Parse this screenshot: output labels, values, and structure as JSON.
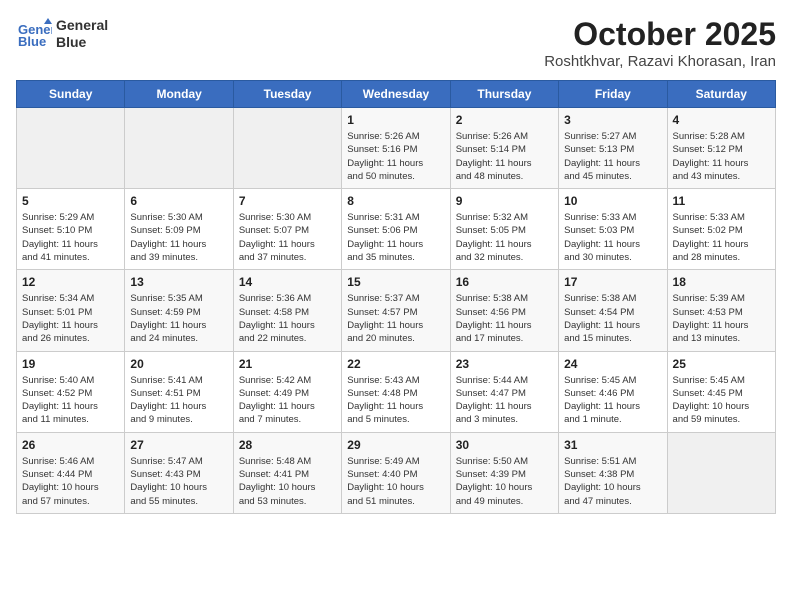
{
  "header": {
    "logo_line1": "General",
    "logo_line2": "Blue",
    "month": "October 2025",
    "location": "Roshtkhvar, Razavi Khorasan, Iran"
  },
  "weekdays": [
    "Sunday",
    "Monday",
    "Tuesday",
    "Wednesday",
    "Thursday",
    "Friday",
    "Saturday"
  ],
  "weeks": [
    [
      {
        "day": "",
        "info": ""
      },
      {
        "day": "",
        "info": ""
      },
      {
        "day": "",
        "info": ""
      },
      {
        "day": "1",
        "info": "Sunrise: 5:26 AM\nSunset: 5:16 PM\nDaylight: 11 hours\nand 50 minutes."
      },
      {
        "day": "2",
        "info": "Sunrise: 5:26 AM\nSunset: 5:14 PM\nDaylight: 11 hours\nand 48 minutes."
      },
      {
        "day": "3",
        "info": "Sunrise: 5:27 AM\nSunset: 5:13 PM\nDaylight: 11 hours\nand 45 minutes."
      },
      {
        "day": "4",
        "info": "Sunrise: 5:28 AM\nSunset: 5:12 PM\nDaylight: 11 hours\nand 43 minutes."
      }
    ],
    [
      {
        "day": "5",
        "info": "Sunrise: 5:29 AM\nSunset: 5:10 PM\nDaylight: 11 hours\nand 41 minutes."
      },
      {
        "day": "6",
        "info": "Sunrise: 5:30 AM\nSunset: 5:09 PM\nDaylight: 11 hours\nand 39 minutes."
      },
      {
        "day": "7",
        "info": "Sunrise: 5:30 AM\nSunset: 5:07 PM\nDaylight: 11 hours\nand 37 minutes."
      },
      {
        "day": "8",
        "info": "Sunrise: 5:31 AM\nSunset: 5:06 PM\nDaylight: 11 hours\nand 35 minutes."
      },
      {
        "day": "9",
        "info": "Sunrise: 5:32 AM\nSunset: 5:05 PM\nDaylight: 11 hours\nand 32 minutes."
      },
      {
        "day": "10",
        "info": "Sunrise: 5:33 AM\nSunset: 5:03 PM\nDaylight: 11 hours\nand 30 minutes."
      },
      {
        "day": "11",
        "info": "Sunrise: 5:33 AM\nSunset: 5:02 PM\nDaylight: 11 hours\nand 28 minutes."
      }
    ],
    [
      {
        "day": "12",
        "info": "Sunrise: 5:34 AM\nSunset: 5:01 PM\nDaylight: 11 hours\nand 26 minutes."
      },
      {
        "day": "13",
        "info": "Sunrise: 5:35 AM\nSunset: 4:59 PM\nDaylight: 11 hours\nand 24 minutes."
      },
      {
        "day": "14",
        "info": "Sunrise: 5:36 AM\nSunset: 4:58 PM\nDaylight: 11 hours\nand 22 minutes."
      },
      {
        "day": "15",
        "info": "Sunrise: 5:37 AM\nSunset: 4:57 PM\nDaylight: 11 hours\nand 20 minutes."
      },
      {
        "day": "16",
        "info": "Sunrise: 5:38 AM\nSunset: 4:56 PM\nDaylight: 11 hours\nand 17 minutes."
      },
      {
        "day": "17",
        "info": "Sunrise: 5:38 AM\nSunset: 4:54 PM\nDaylight: 11 hours\nand 15 minutes."
      },
      {
        "day": "18",
        "info": "Sunrise: 5:39 AM\nSunset: 4:53 PM\nDaylight: 11 hours\nand 13 minutes."
      }
    ],
    [
      {
        "day": "19",
        "info": "Sunrise: 5:40 AM\nSunset: 4:52 PM\nDaylight: 11 hours\nand 11 minutes."
      },
      {
        "day": "20",
        "info": "Sunrise: 5:41 AM\nSunset: 4:51 PM\nDaylight: 11 hours\nand 9 minutes."
      },
      {
        "day": "21",
        "info": "Sunrise: 5:42 AM\nSunset: 4:49 PM\nDaylight: 11 hours\nand 7 minutes."
      },
      {
        "day": "22",
        "info": "Sunrise: 5:43 AM\nSunset: 4:48 PM\nDaylight: 11 hours\nand 5 minutes."
      },
      {
        "day": "23",
        "info": "Sunrise: 5:44 AM\nSunset: 4:47 PM\nDaylight: 11 hours\nand 3 minutes."
      },
      {
        "day": "24",
        "info": "Sunrise: 5:45 AM\nSunset: 4:46 PM\nDaylight: 11 hours\nand 1 minute."
      },
      {
        "day": "25",
        "info": "Sunrise: 5:45 AM\nSunset: 4:45 PM\nDaylight: 10 hours\nand 59 minutes."
      }
    ],
    [
      {
        "day": "26",
        "info": "Sunrise: 5:46 AM\nSunset: 4:44 PM\nDaylight: 10 hours\nand 57 minutes."
      },
      {
        "day": "27",
        "info": "Sunrise: 5:47 AM\nSunset: 4:43 PM\nDaylight: 10 hours\nand 55 minutes."
      },
      {
        "day": "28",
        "info": "Sunrise: 5:48 AM\nSunset: 4:41 PM\nDaylight: 10 hours\nand 53 minutes."
      },
      {
        "day": "29",
        "info": "Sunrise: 5:49 AM\nSunset: 4:40 PM\nDaylight: 10 hours\nand 51 minutes."
      },
      {
        "day": "30",
        "info": "Sunrise: 5:50 AM\nSunset: 4:39 PM\nDaylight: 10 hours\nand 49 minutes."
      },
      {
        "day": "31",
        "info": "Sunrise: 5:51 AM\nSunset: 4:38 PM\nDaylight: 10 hours\nand 47 minutes."
      },
      {
        "day": "",
        "info": ""
      }
    ]
  ]
}
